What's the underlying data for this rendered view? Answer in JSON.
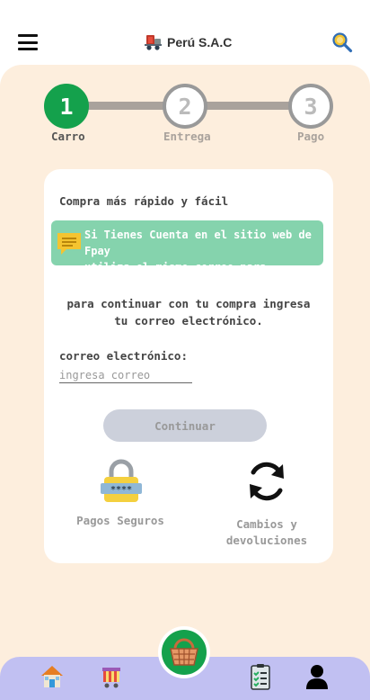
{
  "header": {
    "brand_name": "Perú S.A.C",
    "menu_icon": "hamburger-menu-icon",
    "brand_icon": "delivery-cart-icon",
    "search_icon": "search-magnifier-icon"
  },
  "stepper": {
    "steps": [
      {
        "number": "1",
        "label": "Carro",
        "active": true
      },
      {
        "number": "2",
        "label": "Entrega",
        "active": false
      },
      {
        "number": "3",
        "label": "Pago",
        "active": false
      }
    ]
  },
  "login": {
    "title": "Compra más rápido y fácil",
    "notice_line1": "Si Tienes Cuenta en el sitio web de Fpay",
    "notice_line2": "utiliza el mismo correo para Ingresar",
    "instruction_line1": "para continuar con tu compra ingresa",
    "instruction_line2": "tu correo electrónico.",
    "email_label": "correo electrónico:",
    "email_placeholder": "ingresa correo",
    "email_value": "",
    "continue_label": "Continuar"
  },
  "features": {
    "secure_label": "Pagos Seguros",
    "returns_line1": "Cambios y",
    "returns_line2": "devoluciones"
  },
  "bottom_nav": {
    "items": [
      "home-icon",
      "store-icon",
      "basket-icon",
      "orders-checklist-icon",
      "user-profile-icon"
    ]
  },
  "colors": {
    "accent_green": "#14a14c",
    "notice_green": "#85d3ad",
    "page_background": "#fdeedd",
    "nav_background": "#c1c0f2"
  }
}
